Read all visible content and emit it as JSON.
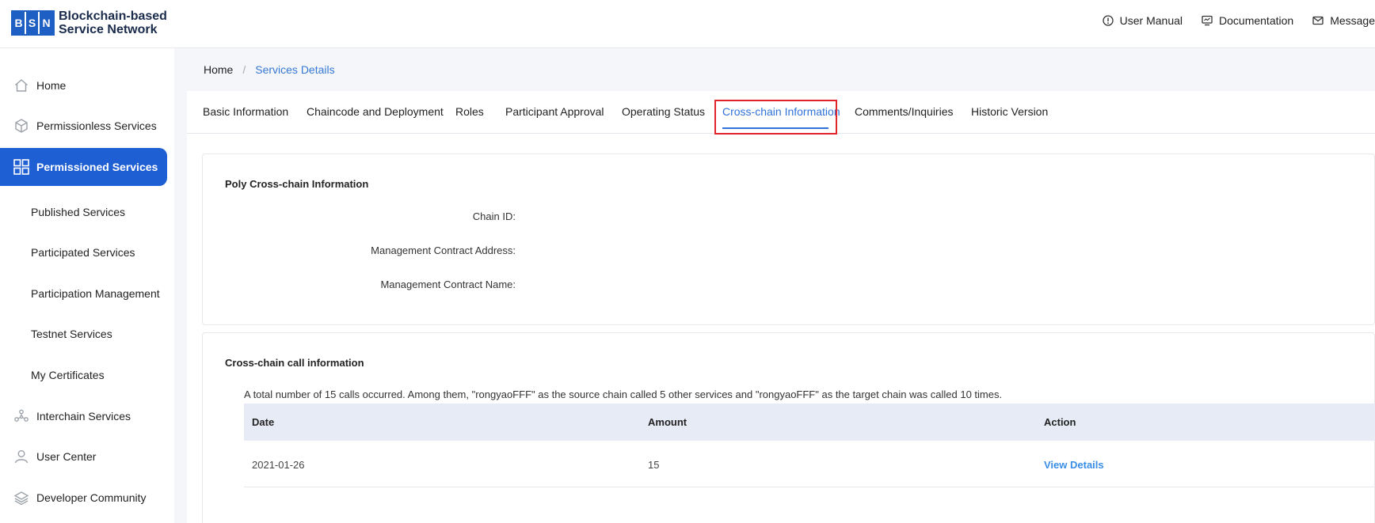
{
  "header": {
    "logo_letters": [
      "B",
      "S",
      "N"
    ],
    "logo_line1": "Blockchain-based",
    "logo_line2": "Service Network",
    "links": [
      {
        "label": "User Manual",
        "icon": "info-circle-icon"
      },
      {
        "label": "Documentation",
        "icon": "monitor-icon"
      },
      {
        "label": "Message",
        "icon": "mail-icon"
      }
    ]
  },
  "sidebar": {
    "items": [
      {
        "label": "Home",
        "icon": "home-icon"
      },
      {
        "label": "Permissionless Services",
        "icon": "cube-icon"
      },
      {
        "label": "Permissioned Services",
        "icon": "grid-icon",
        "active": true
      },
      {
        "label": "Interchain Services",
        "icon": "nodes-icon"
      },
      {
        "label": "User Center",
        "icon": "user-icon"
      },
      {
        "label": "Developer Community",
        "icon": "layers-icon"
      }
    ],
    "subitems": [
      "Published Services",
      "Participated Services",
      "Participation Management",
      "Testnet Services",
      "My Certificates"
    ]
  },
  "breadcrumb": {
    "home": "Home",
    "separator": "/",
    "current": "Services Details"
  },
  "tabs": [
    "Basic Information",
    "Chaincode and Deployment",
    "Roles",
    "Participant Approval",
    "Operating Status",
    "Cross-chain Information",
    "Comments/Inquiries",
    "Historic Version"
  ],
  "active_tab": "Cross-chain Information",
  "poly_card": {
    "title": "Poly Cross-chain Information",
    "fields": [
      {
        "label": "Chain ID:",
        "value": ""
      },
      {
        "label": "Management Contract Address:",
        "value": ""
      },
      {
        "label": "Management Contract Name:",
        "value": ""
      }
    ]
  },
  "calls_card": {
    "title": "Cross-chain call information",
    "summary": "A total number of 15 calls occurred. Among them, \"rongyaoFFF\" as the source chain called 5 other services and \"rongyaoFFF\" as the target chain was called 10 times.",
    "columns": [
      "Date",
      "Amount",
      "Action"
    ],
    "rows": [
      {
        "date": "2021-01-26",
        "amount": "15",
        "action": "View Details"
      }
    ]
  },
  "colors": {
    "brand": "#1e5fc4",
    "active_nav": "#1e5fd4",
    "link": "#2f73d8",
    "highlight_border": "#e0262a",
    "table_header_bg": "#e6ebf5"
  }
}
